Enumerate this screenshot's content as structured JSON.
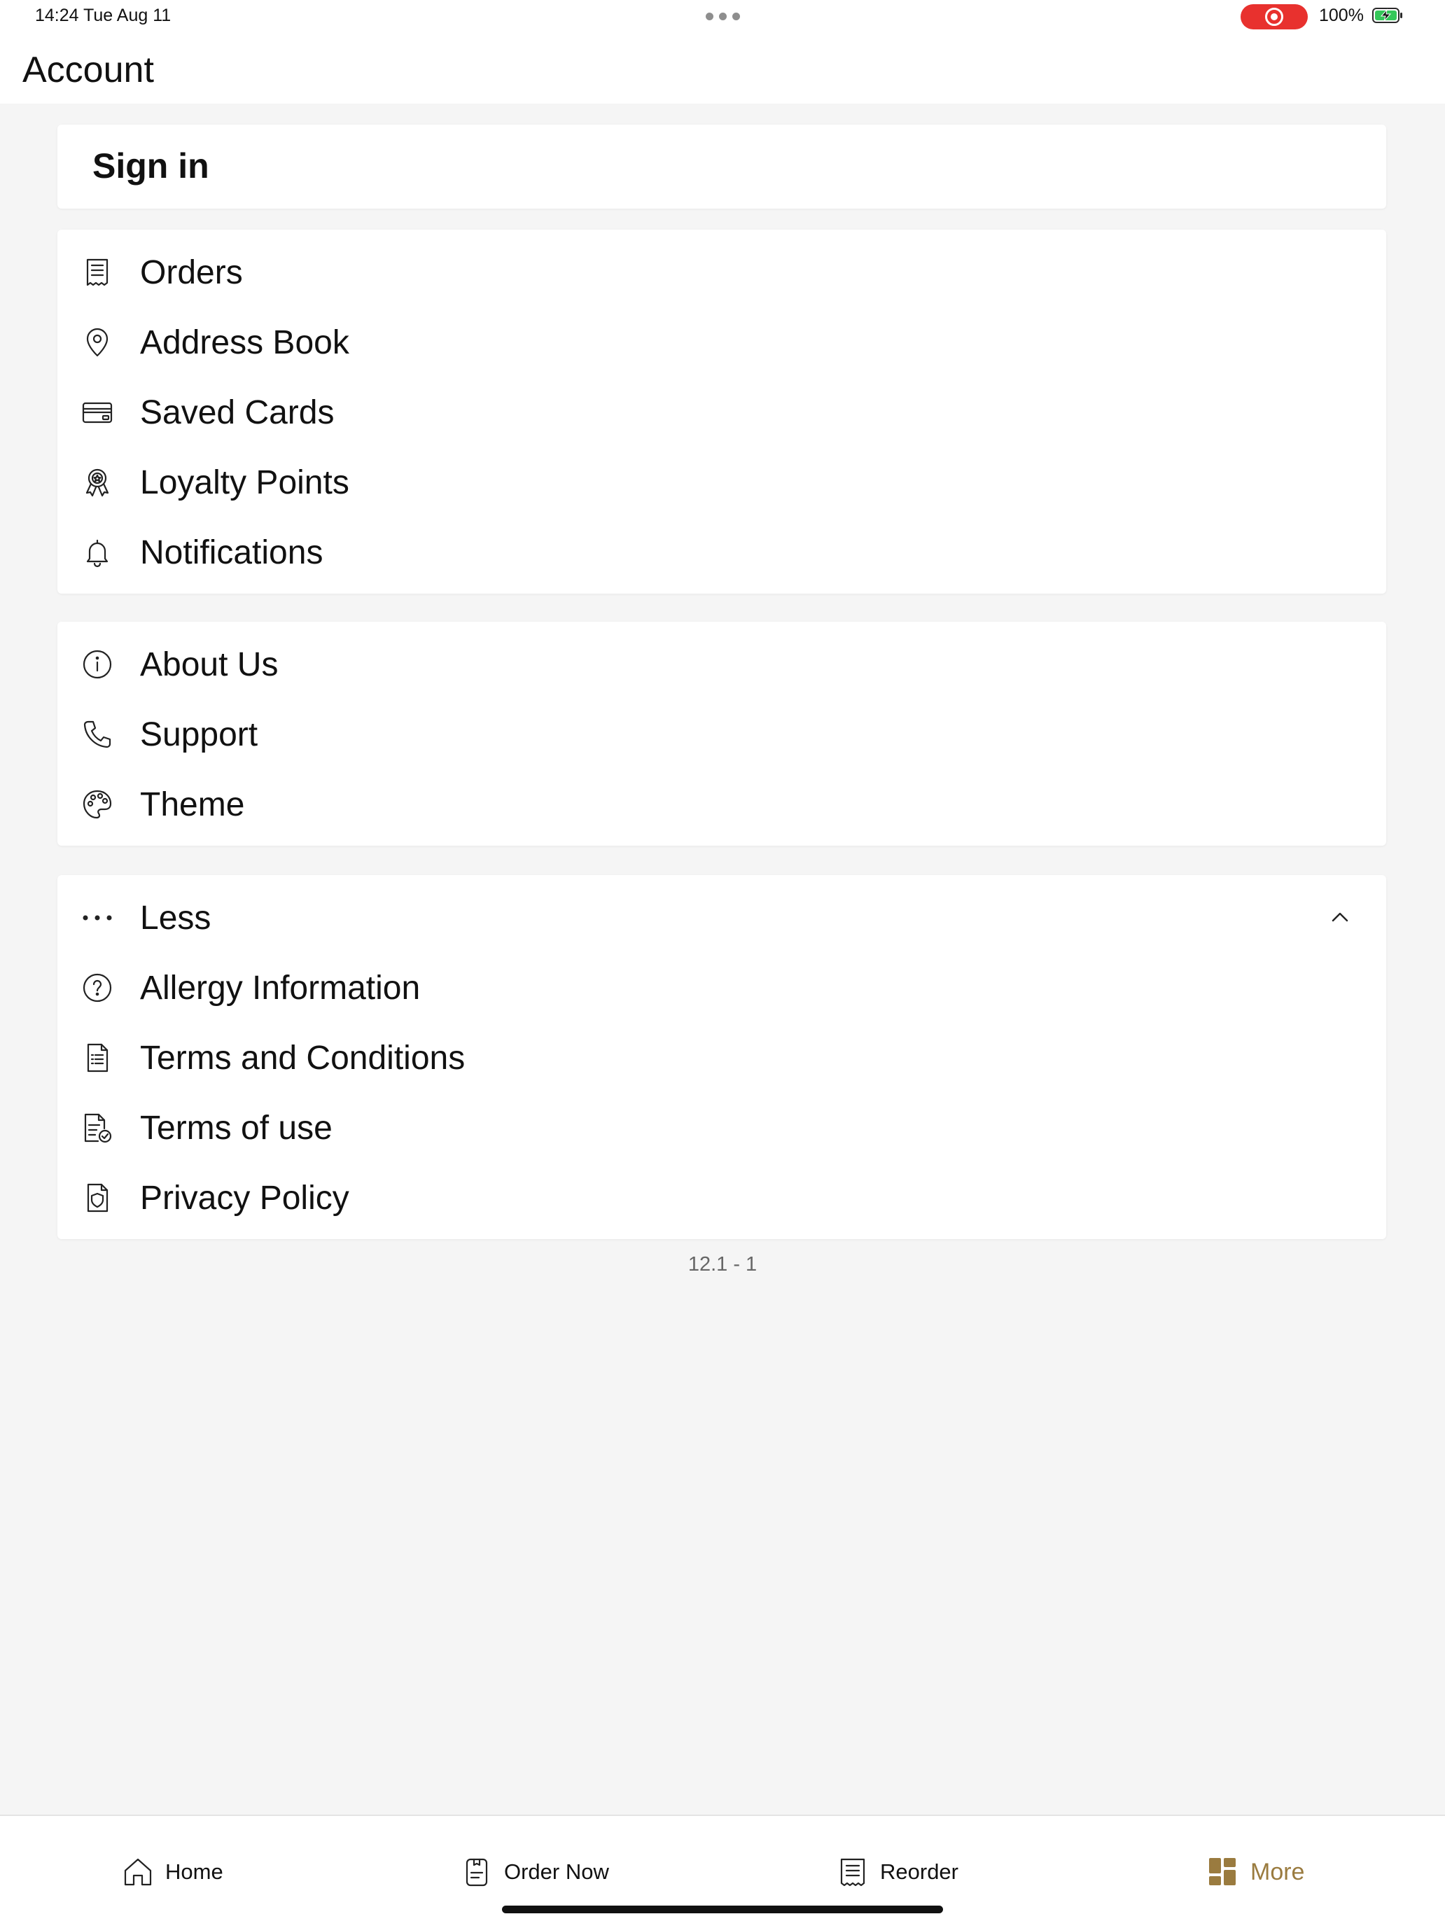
{
  "status_bar": {
    "time_date": "14:24   Tue Aug 11",
    "battery_percent": "100%",
    "recording_color": "#e8312e",
    "battery_color": "#34c759"
  },
  "header": {
    "title": "Account"
  },
  "signin": {
    "label": "Sign in"
  },
  "account_section": {
    "items": [
      {
        "label": "Orders",
        "icon": "receipt-icon"
      },
      {
        "label": "Address Book",
        "icon": "map-pin-icon"
      },
      {
        "label": "Saved Cards",
        "icon": "credit-card-icon"
      },
      {
        "label": "Loyalty Points",
        "icon": "award-ribbon-icon"
      },
      {
        "label": "Notifications",
        "icon": "bell-icon"
      }
    ]
  },
  "info_section": {
    "items": [
      {
        "label": "About Us",
        "icon": "info-icon"
      },
      {
        "label": "Support",
        "icon": "phone-icon"
      },
      {
        "label": "Theme",
        "icon": "palette-icon"
      }
    ]
  },
  "more_section": {
    "toggle_label": "Less",
    "toggle_icon": "more-dots-icon",
    "expanded": true,
    "items": [
      {
        "label": "Allergy Information",
        "icon": "question-circle-icon"
      },
      {
        "label": "Terms and Conditions",
        "icon": "document-list-icon"
      },
      {
        "label": "Terms of use",
        "icon": "document-check-icon"
      },
      {
        "label": "Privacy Policy",
        "icon": "document-shield-icon"
      }
    ]
  },
  "version": "12.1 - 1",
  "tabbar": {
    "accent_color": "#9a7b3f",
    "active_tab": "More",
    "tabs": [
      {
        "label": "Home",
        "icon": "home-icon"
      },
      {
        "label": "Order Now",
        "icon": "order-document-icon"
      },
      {
        "label": "Reorder",
        "icon": "receipt-icon"
      },
      {
        "label": "More",
        "icon": "dashboard-grid-icon"
      }
    ]
  }
}
